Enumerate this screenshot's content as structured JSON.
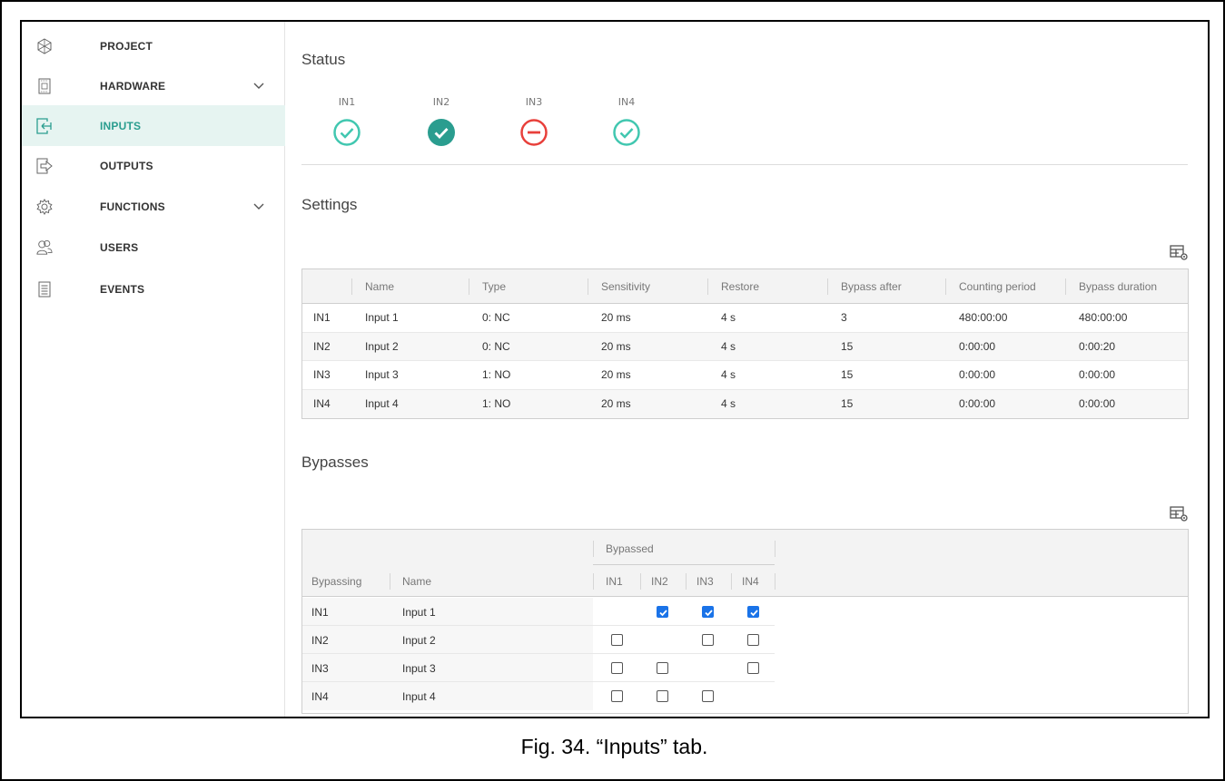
{
  "sidebar": {
    "items": [
      {
        "label": "PROJECT",
        "icon": "project-icon",
        "active": false,
        "has_chevron": false
      },
      {
        "label": "HARDWARE",
        "icon": "hardware-icon",
        "active": false,
        "has_chevron": true
      },
      {
        "label": "INPUTS",
        "icon": "inputs-icon",
        "active": true,
        "has_chevron": false
      },
      {
        "label": "OUTPUTS",
        "icon": "outputs-icon",
        "active": false,
        "has_chevron": false
      },
      {
        "label": "FUNCTIONS",
        "icon": "gear-icon",
        "active": false,
        "has_chevron": true
      },
      {
        "label": "USERS",
        "icon": "users-icon",
        "active": false,
        "has_chevron": false
      },
      {
        "label": "EVENTS",
        "icon": "events-icon",
        "active": false,
        "has_chevron": false
      }
    ]
  },
  "status": {
    "title": "Status",
    "items": [
      {
        "label": "IN1",
        "state": "ok-outline"
      },
      {
        "label": "IN2",
        "state": "ok-filled"
      },
      {
        "label": "IN3",
        "state": "blocked"
      },
      {
        "label": "IN4",
        "state": "ok-outline"
      }
    ]
  },
  "settings": {
    "title": "Settings",
    "columns": [
      "",
      "Name",
      "Type",
      "Sensitivity",
      "Restore",
      "Bypass after",
      "Counting period",
      "Bypass duration"
    ],
    "rows": [
      [
        "IN1",
        "Input 1",
        "0: NC",
        "20 ms",
        "4 s",
        "3",
        "480:00:00",
        "480:00:00"
      ],
      [
        "IN2",
        "Input 2",
        "0: NC",
        "20 ms",
        "4 s",
        "15",
        "0:00:00",
        "0:00:20"
      ],
      [
        "IN3",
        "Input 3",
        "1: NO",
        "20 ms",
        "4 s",
        "15",
        "0:00:00",
        "0:00:00"
      ],
      [
        "IN4",
        "Input 4",
        "1: NO",
        "20 ms",
        "4 s",
        "15",
        "0:00:00",
        "0:00:00"
      ]
    ]
  },
  "bypasses": {
    "title": "Bypasses",
    "group_header": "Bypassed",
    "col_bypassing": "Bypassing",
    "col_name": "Name",
    "input_columns": [
      "IN1",
      "IN2",
      "IN3",
      "IN4"
    ],
    "rows": [
      {
        "id": "IN1",
        "name": "Input 1",
        "checks": [
          null,
          true,
          true,
          true
        ]
      },
      {
        "id": "IN2",
        "name": "Input 2",
        "checks": [
          false,
          null,
          false,
          false
        ]
      },
      {
        "id": "IN3",
        "name": "Input 3",
        "checks": [
          false,
          false,
          null,
          false
        ]
      },
      {
        "id": "IN4",
        "name": "Input 4",
        "checks": [
          false,
          false,
          false,
          null
        ]
      }
    ]
  },
  "caption": "Fig. 34. “Inputs” tab.",
  "colors": {
    "accent": "#2a9d8f",
    "ok": "#41c7b0",
    "ok_filled": "#2a9d8f",
    "blocked": "#e8403b",
    "checkbox": "#1a73e8",
    "active_bg": "#e6f4f1"
  }
}
